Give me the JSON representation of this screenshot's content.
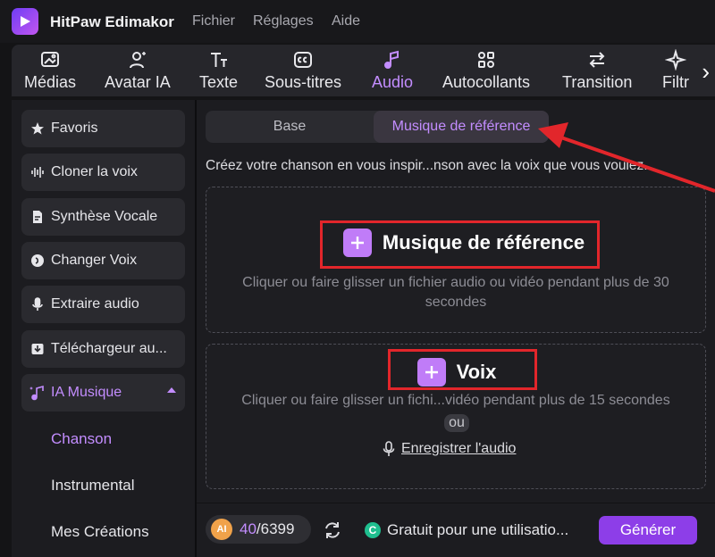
{
  "app": {
    "title": "HitPaw Edimakor"
  },
  "menu": [
    "Fichier",
    "Réglages",
    "Aide"
  ],
  "toolbar": {
    "items": [
      {
        "label": "Médias",
        "icon": "media-icon"
      },
      {
        "label": "Avatar IA",
        "icon": "avatar-icon"
      },
      {
        "label": "Texte",
        "icon": "text-icon"
      },
      {
        "label": "Sous-titres",
        "icon": "subtitles-icon"
      },
      {
        "label": "Audio",
        "icon": "music-note-icon",
        "active": true
      },
      {
        "label": "Autocollants",
        "icon": "stickers-icon"
      },
      {
        "label": "Transition",
        "icon": "transition-icon"
      },
      {
        "label": "Filtr",
        "icon": "filter-icon"
      }
    ]
  },
  "sidebar": {
    "items": [
      {
        "label": "Favoris",
        "icon": "star-icon"
      },
      {
        "label": "Cloner la voix",
        "icon": "waveform-icon"
      },
      {
        "label": "Synthèse Vocale",
        "icon": "document-voice-icon"
      },
      {
        "label": "Changer Voix",
        "icon": "voice-changer-icon"
      },
      {
        "label": "Extraire audio",
        "icon": "microphone-icon"
      },
      {
        "label": "Téléchargeur au...",
        "icon": "download-icon"
      },
      {
        "label": "IA Musique",
        "icon": "ai-music-icon",
        "active": true,
        "expanded": true
      }
    ],
    "subitems": [
      {
        "label": "Chanson",
        "active": true
      },
      {
        "label": "Instrumental"
      },
      {
        "label": "Mes Créations"
      }
    ]
  },
  "tabs": [
    {
      "label": "Base"
    },
    {
      "label": "Musique de référence",
      "active": true
    }
  ],
  "description": "Créez votre chanson en vous inspir...nson avec la voix que vous voulez.",
  "reference_zone": {
    "title": "Musique de référence",
    "help": "Cliquer ou faire glisser un fichier audio ou vidéo pendant plus de 30 secondes"
  },
  "voice_zone": {
    "title": "Voix",
    "help": "Cliquer ou faire glisser un fichi...vidéo pendant plus de 15 secondes",
    "or": "ou",
    "record": "Enregistrer l'audio"
  },
  "bottom": {
    "ai_badge": "AI",
    "credits_used": "40",
    "credits_total": "/6399",
    "free_badge": "C",
    "free_text": "Gratuit pour une utilisatio...",
    "generate": "Générer"
  },
  "colors": {
    "accent": "#c38dff",
    "button": "#8d3ee8",
    "annotation_red": "#e2262b"
  }
}
